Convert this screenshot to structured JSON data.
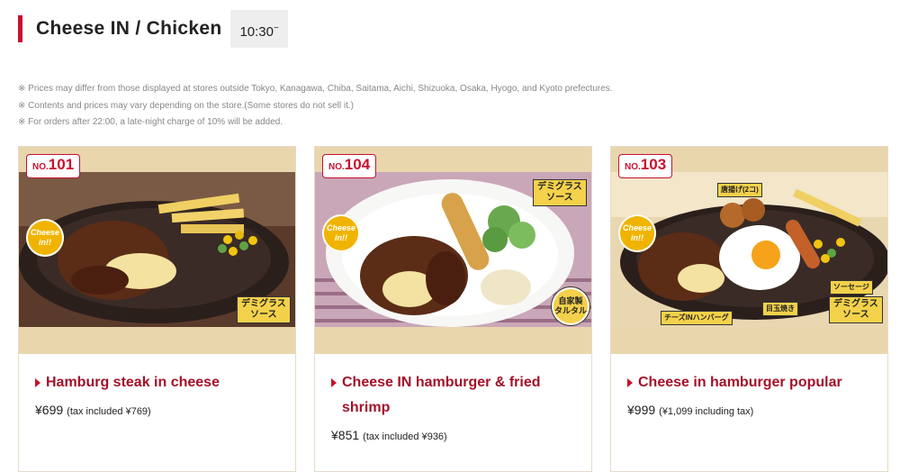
{
  "header": {
    "title": "Cheese IN / Chicken",
    "time_label": "10:30",
    "time_suffix": "~"
  },
  "notes": [
    "※ Prices may differ from those displayed at stores outside Tokyo, Kanagawa, Chiba, Saitama, Aichi, Shizuoka, Osaka, Hyogo, and Kyoto prefectures.",
    "※ Contents and prices may vary depending on the store.(Some stores do not sell it.)",
    "※ For orders after 22:00, a late-night charge of 10% will be added."
  ],
  "cards": [
    {
      "no_prefix": "NO.",
      "no": "101",
      "title": "Hamburg steak in cheese",
      "price": "¥699",
      "tax": "(tax included ¥769)",
      "sauce_tag": "デミグラス\nソース",
      "cheese_badge": "Cheese in!!"
    },
    {
      "no_prefix": "NO.",
      "no": "104",
      "title": "Cheese IN hamburger & fried shrimp",
      "price": "¥851",
      "tax": "(tax included ¥936)",
      "sauce_tag": "デミグラス\nソース",
      "cheese_badge": "Cheese in!!",
      "extra_badge": "自家製\nタルタル"
    },
    {
      "no_prefix": "NO.",
      "no": "103",
      "title": "Cheese in hamburger popular",
      "price": "¥999",
      "tax": "(¥1,099 including tax)",
      "sauce_tag": "デミグラス\nソース",
      "cheese_badge": "Cheese in!!",
      "labels": [
        "唐揚げ(2コ)",
        "ソーセージ",
        "目玉焼き",
        "チーズINハンバーグ"
      ]
    }
  ],
  "colors": {
    "accent": "#c8102e",
    "title_red": "#a3122a",
    "card_top": "#e9d6ad"
  }
}
